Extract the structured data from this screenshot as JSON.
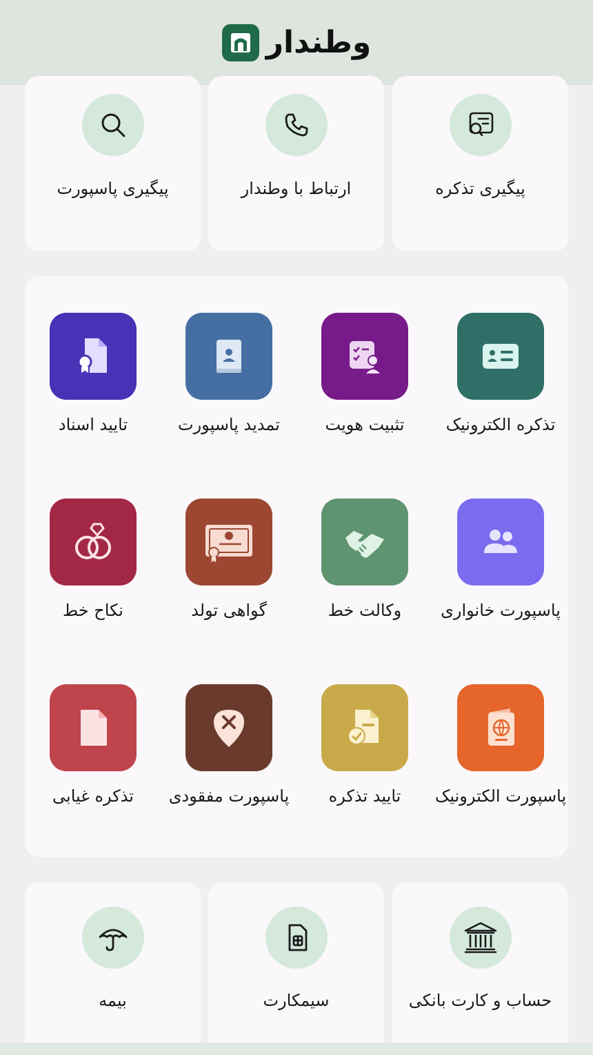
{
  "header": {
    "brand": "وطندار",
    "logo_icon": "gate-icon"
  },
  "top_services": [
    {
      "label": "پیگیری پاسپورت",
      "icon": "search-icon"
    },
    {
      "label": "ارتباط با وطندار",
      "icon": "phone-icon"
    },
    {
      "label": "پیگیری تذکره",
      "icon": "document-search-icon"
    }
  ],
  "services": [
    {
      "label": "تایید اسناد",
      "icon": "certificate-file-icon",
      "color": "#4932b5"
    },
    {
      "label": "تمدید پاسپورت",
      "icon": "passport-book-icon",
      "color": "#456fa3"
    },
    {
      "label": "تثبیت هویت",
      "icon": "identity-check-icon",
      "color": "#771a8a"
    },
    {
      "label": "تذکره الکترونیک",
      "icon": "id-card-icon",
      "color": "#2f6f67"
    },
    {
      "label": "نکاح خط",
      "icon": "rings-icon",
      "color": "#a32845"
    },
    {
      "label": "گواهی تولد",
      "icon": "birth-certificate-icon",
      "color": "#9c4732"
    },
    {
      "label": "وکالت خط",
      "icon": "handshake-icon",
      "color": "#5e9470"
    },
    {
      "label": "پاسپورت خانواری",
      "icon": "family-icon",
      "color": "#7b6bef"
    },
    {
      "label": "تذکره غیابی",
      "icon": "blank-document-icon",
      "color": "#c0444c"
    },
    {
      "label": "پاسپورت مفقودی",
      "icon": "lost-pin-icon",
      "color": "#6a3b2d"
    },
    {
      "label": "تایید تذکره",
      "icon": "verified-document-icon",
      "color": "#c9aa4a"
    },
    {
      "label": "پاسپورت الکترونیک",
      "icon": "e-passport-icon",
      "color": "#e5652a"
    }
  ],
  "bottom_services": [
    {
      "label": "بیمه",
      "icon": "umbrella-icon"
    },
    {
      "label": "سیمکارت",
      "icon": "sim-card-icon"
    },
    {
      "label": "حساب و کارت بانکی",
      "icon": "bank-icon"
    }
  ]
}
